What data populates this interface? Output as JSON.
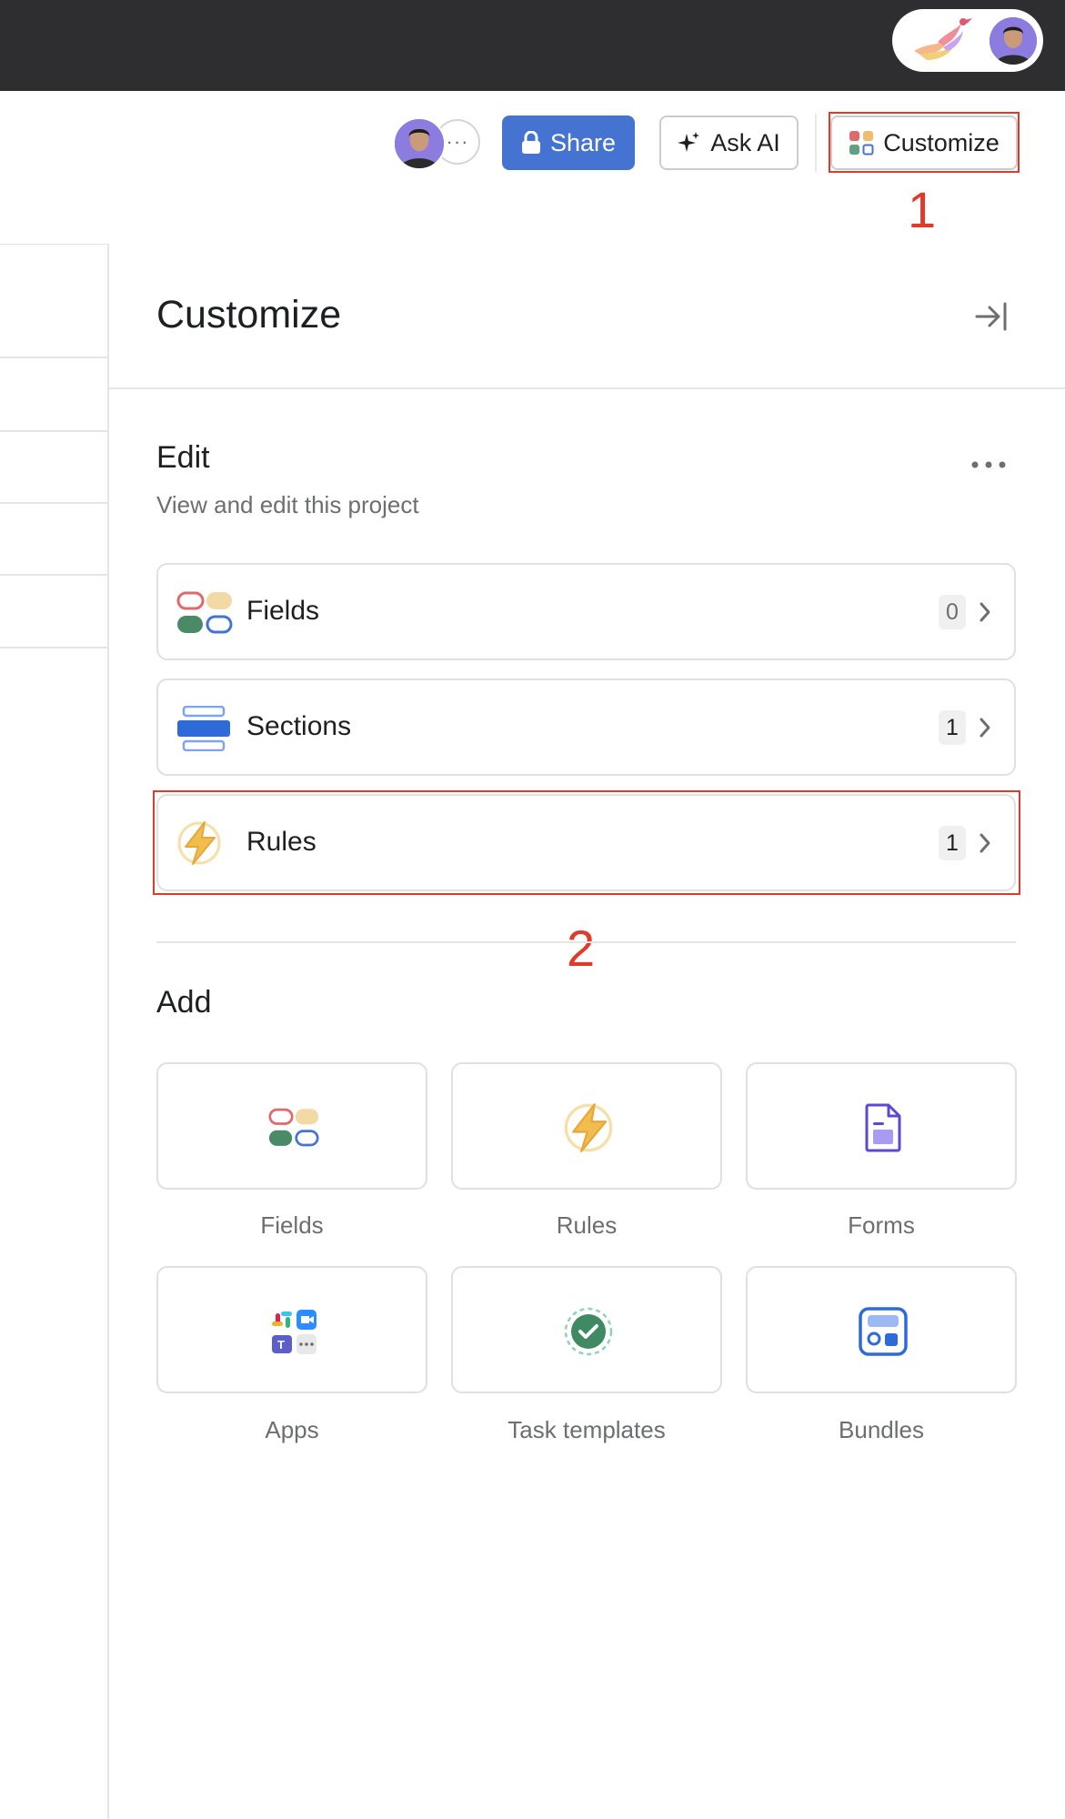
{
  "toolbar": {
    "share_label": "Share",
    "ask_ai_label": "Ask AI",
    "customize_label": "Customize",
    "more_label": "···"
  },
  "annotations": {
    "step_1": "1",
    "step_2": "2"
  },
  "panel": {
    "title": "Customize",
    "edit": {
      "title": "Edit",
      "subtitle": "View and edit this project",
      "rows": [
        {
          "label": "Fields",
          "count": "0",
          "icon": "fields-icon"
        },
        {
          "label": "Sections",
          "count": "1",
          "icon": "sections-icon"
        },
        {
          "label": "Rules",
          "count": "1",
          "icon": "rules-icon"
        }
      ]
    },
    "add": {
      "title": "Add",
      "tiles": [
        {
          "label": "Fields",
          "icon": "fields-icon"
        },
        {
          "label": "Rules",
          "icon": "lightning-icon"
        },
        {
          "label": "Forms",
          "icon": "form-document-icon"
        },
        {
          "label": "Apps",
          "icon": "apps-icon"
        },
        {
          "label": "Task templates",
          "icon": "task-template-icon"
        },
        {
          "label": "Bundles",
          "icon": "bundle-icon"
        }
      ]
    }
  },
  "colors": {
    "share_button": "#4573d2",
    "highlight": "#e03a2b",
    "topbar": "#2e2e30",
    "rules_bolt": "#f1bd4f"
  }
}
